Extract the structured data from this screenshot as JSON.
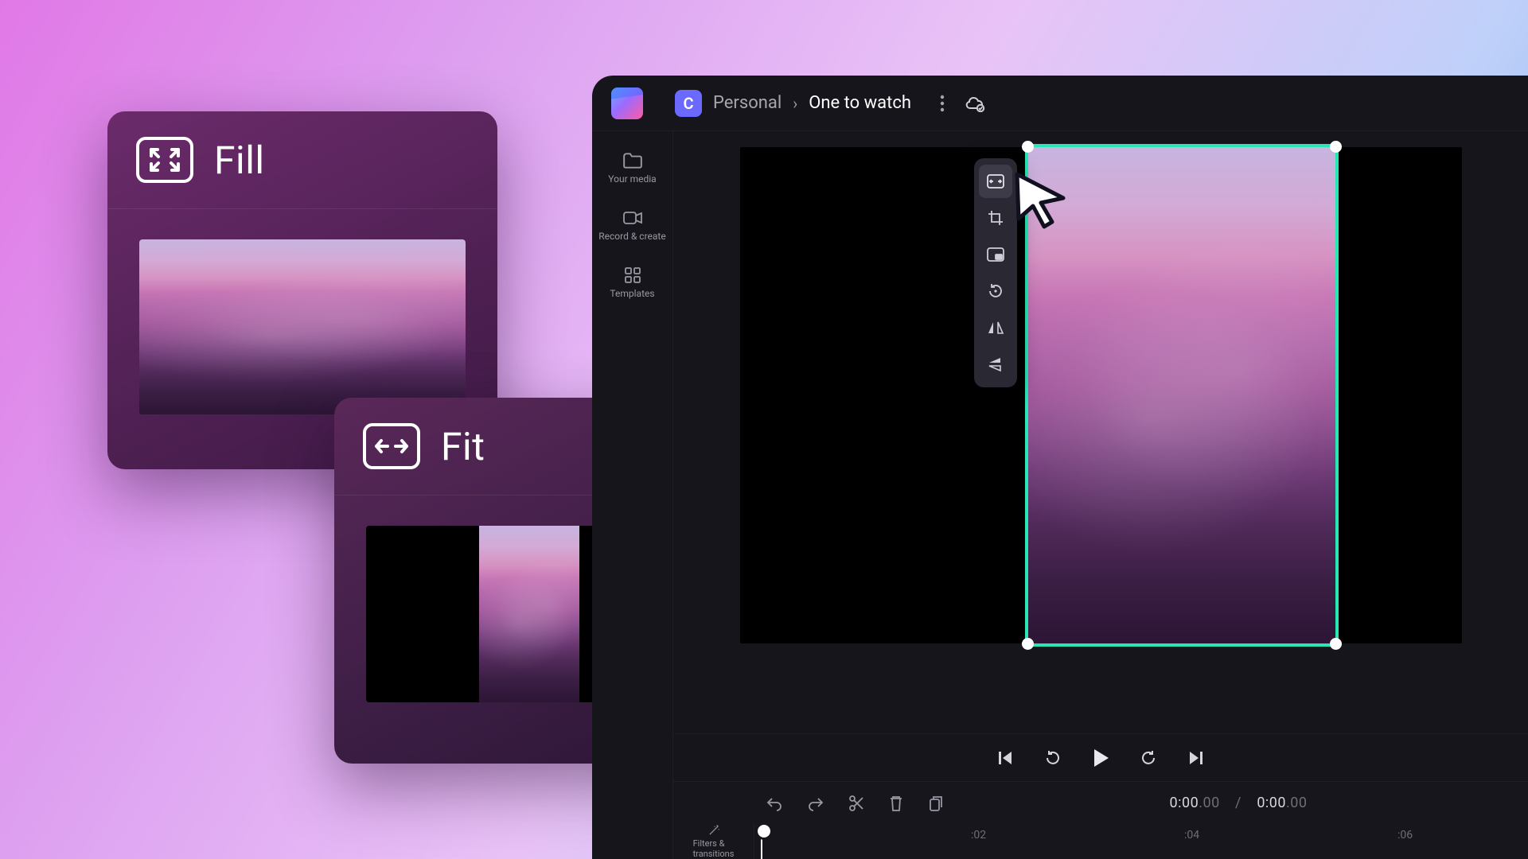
{
  "options": {
    "fill": {
      "label": "Fill",
      "icon": "expand-icon"
    },
    "fit": {
      "label": "Fit",
      "icon": "fit-width-icon"
    }
  },
  "topbar": {
    "workspace_initial": "C",
    "workspace_name": "Personal",
    "project_name": "One to watch"
  },
  "sidebar": {
    "items": [
      {
        "label": "Your media",
        "icon": "folder-icon"
      },
      {
        "label": "Record & create",
        "icon": "camera-icon"
      },
      {
        "label": "Templates",
        "icon": "templates-icon"
      }
    ],
    "filters_label": "Filters &\ntransitions"
  },
  "float_toolbar": {
    "items": [
      {
        "name": "fit-tool-button",
        "icon": "fit-width-icon",
        "active": true
      },
      {
        "name": "crop-tool-button",
        "icon": "crop-icon"
      },
      {
        "name": "pip-tool-button",
        "icon": "pip-icon"
      },
      {
        "name": "rotate-tool-button",
        "icon": "rotate-icon"
      },
      {
        "name": "flip-h-tool-button",
        "icon": "flip-h-icon"
      },
      {
        "name": "flip-v-tool-button",
        "icon": "flip-v-icon"
      }
    ]
  },
  "playback": {
    "buttons": [
      "prev-frame-button",
      "rewind-button",
      "play-button",
      "forward-button",
      "next-frame-button"
    ]
  },
  "timeline": {
    "tools": [
      "undo-button",
      "redo-button",
      "split-button",
      "delete-button",
      "duplicate-button"
    ],
    "time_current": "0:00",
    "time_current_frac": ".00",
    "time_sep": "/",
    "time_total": "0:00",
    "time_total_frac": ".00",
    "ruler_ticks": [
      ":02",
      ":04",
      ":06"
    ]
  },
  "colors": {
    "selection": "#29e6b7"
  }
}
